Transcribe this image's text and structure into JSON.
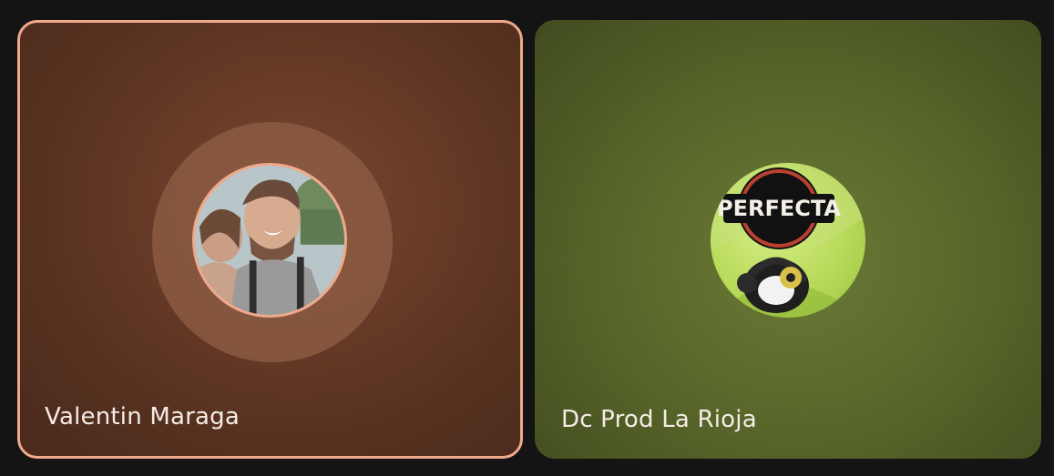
{
  "participants": [
    {
      "name": "Valentin Maraga",
      "speaking": true,
      "accent_color": "#f0a98a"
    },
    {
      "name": "Dc Prod La Rioja",
      "speaking": false,
      "logo_text": "PERFECTA"
    }
  ]
}
